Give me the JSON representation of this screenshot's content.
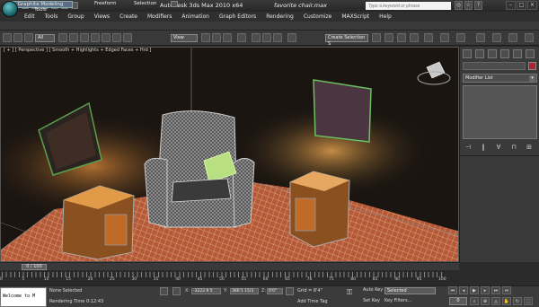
{
  "title": {
    "app": "Autodesk 3ds Max  2010 x64",
    "document": "favorite chair.max",
    "search_placeholder": "Type a keyword or phrase"
  },
  "menu": [
    "Edit",
    "Tools",
    "Group",
    "Views",
    "Create",
    "Modifiers",
    "Animation",
    "Graph Editors",
    "Rendering",
    "Customize",
    "MAXScript",
    "Help"
  ],
  "ribbon": {
    "tabs": [
      "Graphite Modeling Tools",
      "Freeform",
      "Selection"
    ]
  },
  "toolbar": {
    "selection_filter": "All",
    "reference_coord": "View",
    "named_selection_set": "Create Selection S"
  },
  "viewport": {
    "label": "[ + ] [ Perspective ] [ Smooth + Highlights + Edged Faces + Hrd ]"
  },
  "command_panel": {
    "modifier_list": "Modifier List",
    "object_color": "#b02030"
  },
  "timeline": {
    "frame_label": "0 / 100",
    "ticks": [
      "0",
      "5",
      "10",
      "15",
      "20",
      "25",
      "30",
      "35",
      "40",
      "45",
      "50",
      "55",
      "60",
      "65",
      "70",
      "75",
      "80",
      "85",
      "90",
      "95",
      "100"
    ]
  },
  "status": {
    "maxscript": "Welcome to M",
    "selection": "None Selected",
    "render_time": "Rendering Time  0:12:43",
    "x_label": "X:",
    "x_value": "-3222.9 5",
    "y_label": "Y:",
    "y_value": "366'1 15/3",
    "z_label": "Z:",
    "z_value": "0'0\"",
    "grid": "Grid = 8'4\"",
    "add_time_tag": "Add Time Tag",
    "auto_key": "Auto Key",
    "set_key": "Set Key",
    "key_mode": "Selected",
    "key_filters": "Key Filters...",
    "current_frame": "0"
  }
}
